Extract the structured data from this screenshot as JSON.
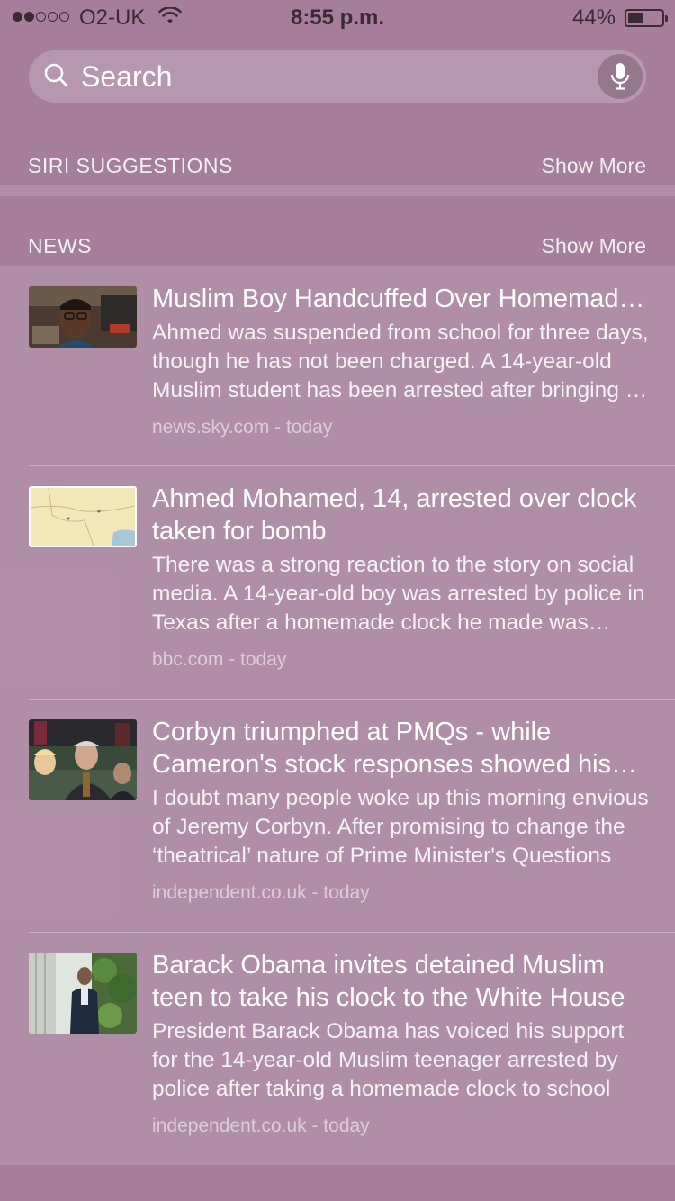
{
  "status_bar": {
    "signal_dots_filled": 2,
    "signal_dots_total": 5,
    "carrier": "O2-UK",
    "time": "8:55 p.m.",
    "battery_percent": "44%",
    "battery_level": 0.44
  },
  "search": {
    "placeholder": "Search"
  },
  "siri_suggestions": {
    "title": "SIRI SUGGESTIONS",
    "show_more": "Show More"
  },
  "news": {
    "title": "NEWS",
    "show_more": "Show More",
    "items": [
      {
        "title": "Muslim Boy Handcuffed Over Homemade Clock",
        "summary": "Ahmed was suspended from school for three days, though he has not been charged. A 14-year-old Muslim student has been arrested after bringing a homemade clock to school",
        "source": "news.sky.com - today"
      },
      {
        "title": "Ahmed Mohamed, 14, arrested over clock taken for bomb",
        "summary": "There was a strong reaction to the story on social media. A 14-year-old boy was arrested by police in Texas after a homemade clock he made was mistaken for a bomb",
        "source": "bbc.com - today"
      },
      {
        "title": "Corbyn triumphed at PMQs - while Cameron's stock responses showed his weakness",
        "summary": "I doubt many people woke up this morning envious of Jeremy Corbyn. After promising to change the ‘theatrical’ nature of Prime Minister's Questions",
        "source": "independent.co.uk - today"
      },
      {
        "title": "Barack Obama invites detained Muslim teen to take his clock to the White House",
        "summary": "President Barack Obama has voiced his support for the 14-year-old Muslim teenager arrested by police after taking a homemade clock to school",
        "source": "independent.co.uk - today"
      }
    ]
  }
}
